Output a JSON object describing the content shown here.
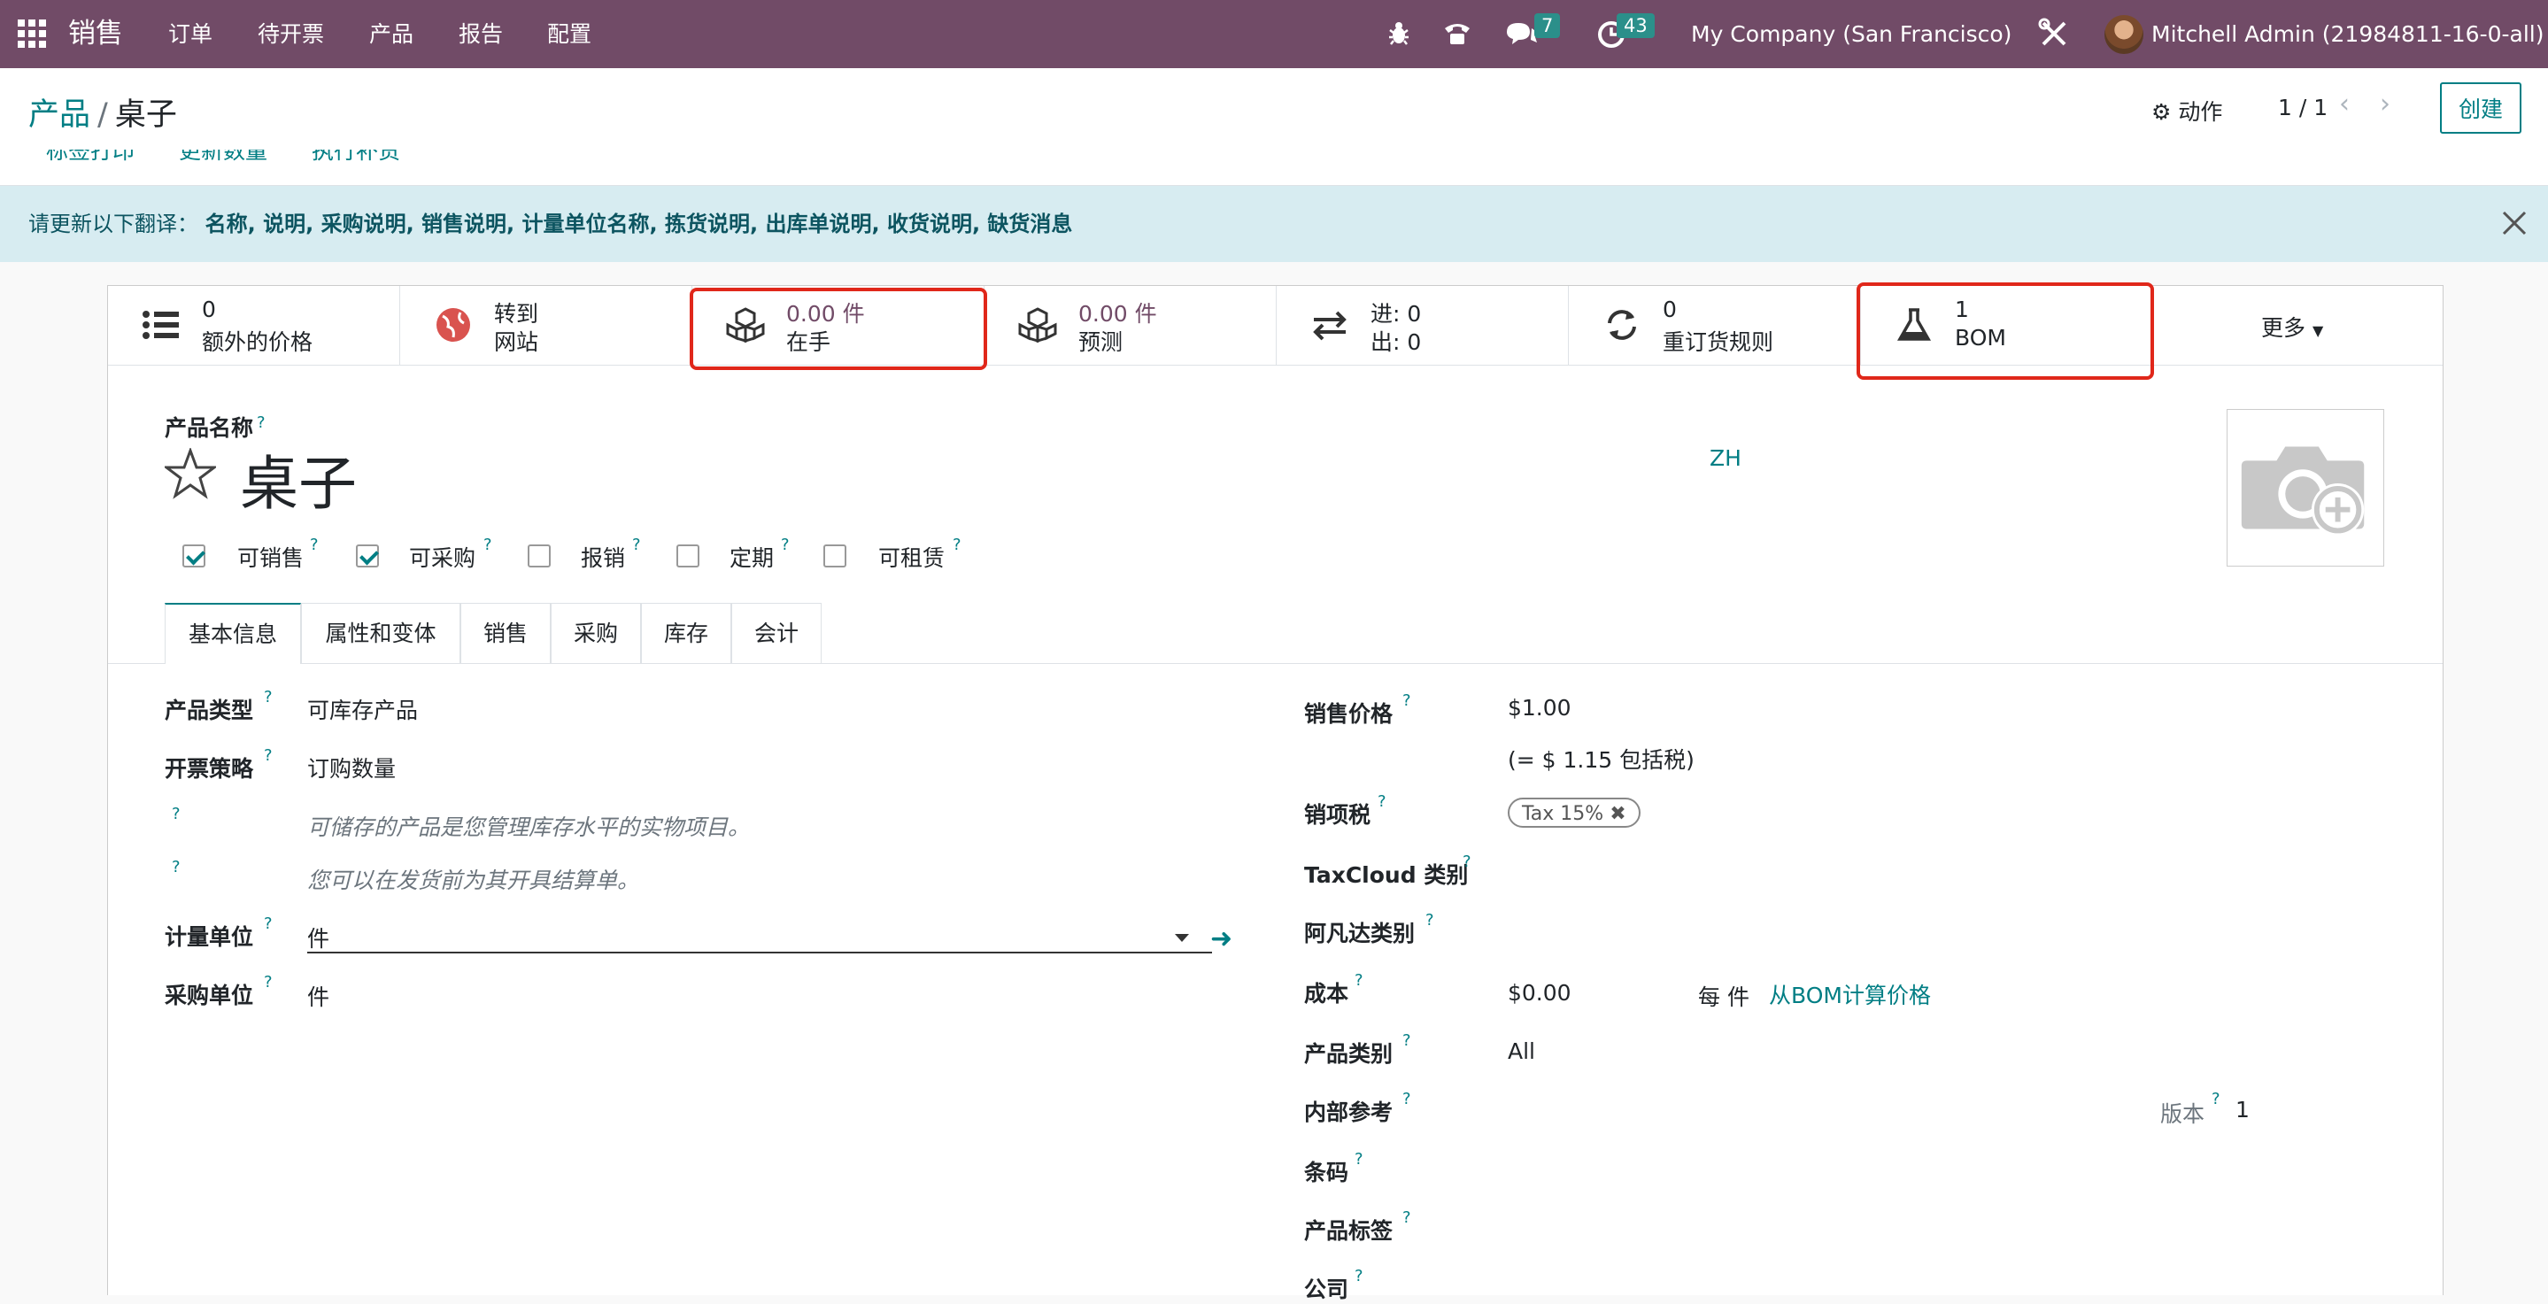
{
  "navbar": {
    "brand": "销售",
    "menu": [
      "订单",
      "待开票",
      "产品",
      "报告",
      "配置"
    ],
    "messages_count": "7",
    "activities_count": "43",
    "company": "My Company (San Francisco)",
    "user": "Mitchell Admin (21984811-16-0-all)"
  },
  "breadcrumb": {
    "parent": "产品",
    "separator": "/",
    "current": "桌子"
  },
  "toolbar": {
    "action_label": "动作",
    "pager": "1 / 1",
    "create_label": "创建"
  },
  "header_buttons": [
    "标签打印",
    "更新数量",
    "执行补货"
  ],
  "alert": {
    "prefix": "请更新以下翻译：",
    "fields": "名称, 说明, 采购说明, 销售说明, 计量单位名称, 拣货说明, 出库单说明, 收货说明, 缺货消息"
  },
  "stats": [
    {
      "value": "0",
      "label": "额外的价格",
      "icon": "list-icon"
    },
    {
      "value": "转到",
      "label": "网站",
      "icon": "globe-icon"
    },
    {
      "value": "0.00 件",
      "label": "在手",
      "icon": "cubes-icon"
    },
    {
      "value": "0.00 件",
      "label": "预测",
      "icon": "cubes-icon"
    },
    {
      "value": "进:  0",
      "label": "出:  0",
      "icon": "exchange-icon"
    },
    {
      "value": "0",
      "label": "重订货规则",
      "icon": "refresh-icon"
    },
    {
      "value": "1",
      "label": "BOM",
      "icon": "flask-icon"
    }
  ],
  "more_label": "更多",
  "product": {
    "name_label": "产品名称",
    "name": "桌子",
    "lang": "ZH",
    "options": [
      {
        "label": "可销售",
        "checked": true
      },
      {
        "label": "可采购",
        "checked": true
      },
      {
        "label": "报销",
        "checked": false
      },
      {
        "label": "定期",
        "checked": false
      },
      {
        "label": "可租赁",
        "checked": false
      }
    ]
  },
  "tabs": [
    "基本信息",
    "属性和变体",
    "销售",
    "采购",
    "库存",
    "会计"
  ],
  "general": {
    "type_label": "产品类型",
    "type_value": "可库存产品",
    "invoice_label": "开票策略",
    "invoice_value": "订购数量",
    "hint1": "可储存的产品是您管理库存水平的实物项目。",
    "hint2": "您可以在发货前为其开具结算单。",
    "uom_label": "计量单位",
    "uom_value": "件",
    "po_uom_label": "采购单位",
    "po_uom_value": "件"
  },
  "right": {
    "price_label": "销售价格",
    "price_value": "$1.00",
    "price_incl": "(= $ 1.15 包括税)",
    "tax_label": "销项税",
    "tax_value": "Tax 15%",
    "taxcloud_label": "TaxCloud 类别",
    "avatax_label": "阿凡达类别",
    "cost_label": "成本",
    "cost_value": "$0.00",
    "cost_per": "每 件",
    "cost_bom_link": "从BOM计算价格",
    "categ_label": "产品类别",
    "categ_value": "All",
    "ref_label": "内部参考",
    "version_label": "版本",
    "version_value": "1",
    "barcode_label": "条码",
    "tags_label": "产品标签",
    "company_label": "公司"
  },
  "colors": {
    "navbar": "#714b67",
    "accent": "#017e84",
    "highlight": "#e0271a",
    "alert_bg": "#d7ecf1"
  }
}
